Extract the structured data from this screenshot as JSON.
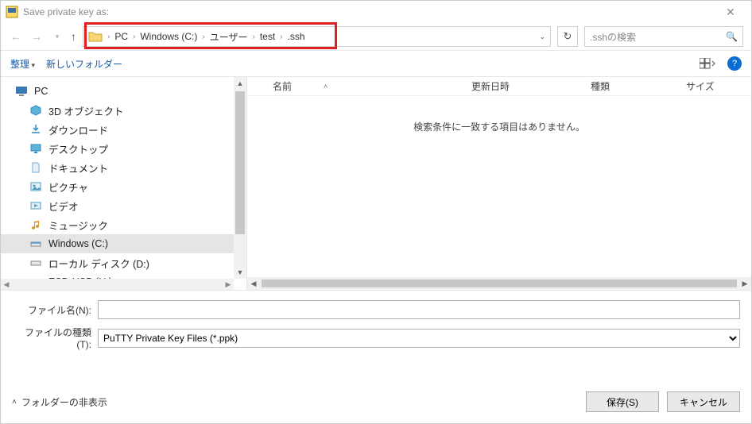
{
  "window": {
    "title": "Save private key as:"
  },
  "nav": {
    "breadcrumbs": [
      "PC",
      "Windows (C:)",
      "ユーザー",
      "test",
      ".ssh"
    ],
    "search_placeholder": ".sshの検索"
  },
  "toolbar": {
    "organize": "整理",
    "new_folder": "新しいフォルダー"
  },
  "sidebar": {
    "pc_label": "PC",
    "items": [
      {
        "label": "3D オブジェクト",
        "icon": "cube",
        "color": "#2b8cc4"
      },
      {
        "label": "ダウンロード",
        "icon": "download",
        "color": "#2b8cc4"
      },
      {
        "label": "デスクトップ",
        "icon": "desktop",
        "color": "#2b8cc4"
      },
      {
        "label": "ドキュメント",
        "icon": "doc",
        "color": "#6faed8"
      },
      {
        "label": "ピクチャ",
        "icon": "picture",
        "color": "#4aa0c4"
      },
      {
        "label": "ビデオ",
        "icon": "video",
        "color": "#4aa0c4"
      },
      {
        "label": "ミュージック",
        "icon": "music",
        "color": "#d99a2b"
      },
      {
        "label": "Windows (C:)",
        "icon": "drive",
        "color": "#5aa9dd",
        "selected": true
      },
      {
        "label": "ローカル ディスク (D:)",
        "icon": "drive",
        "color": "#888"
      },
      {
        "label": "ESD-USB (H:)",
        "icon": "usb",
        "color": "#d9534f"
      }
    ]
  },
  "columns": {
    "name": "名前",
    "date": "更新日時",
    "type": "種類",
    "size": "サイズ"
  },
  "empty_message": "検索条件に一致する項目はありません。",
  "form": {
    "filename_label": "ファイル名(N):",
    "filename_value": "",
    "filetype_label": "ファイルの種類(T):",
    "filetype_value": "PuTTY Private Key Files (*.ppk)"
  },
  "footer": {
    "hide_folders": "フォルダーの非表示",
    "save": "保存(S)",
    "cancel": "キャンセル"
  }
}
